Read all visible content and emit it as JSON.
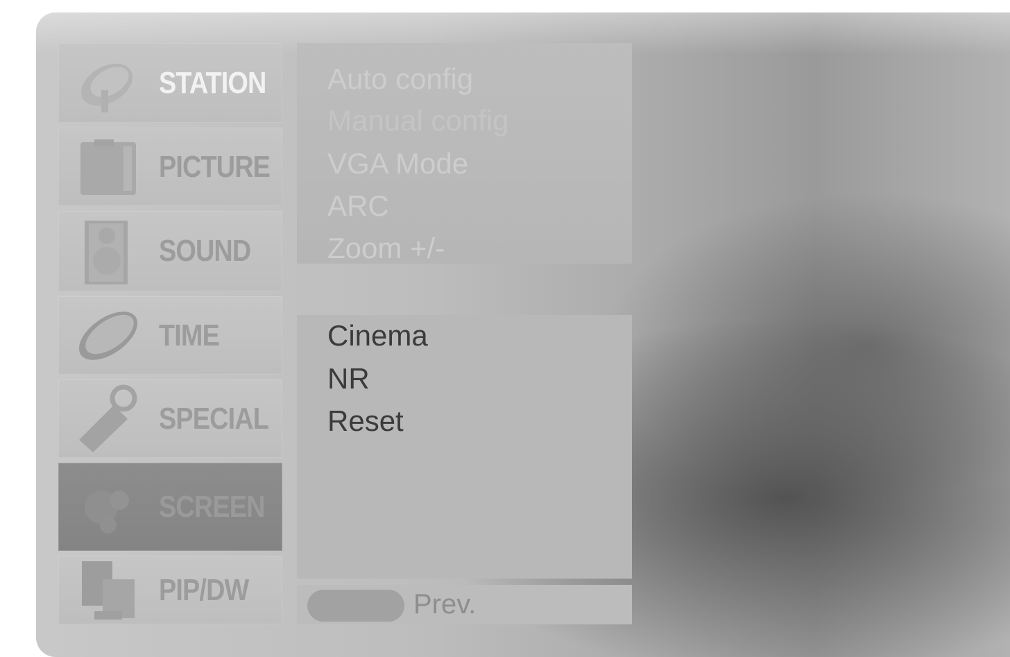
{
  "main_menu": {
    "items": [
      {
        "label": "STATION",
        "icon": "satellite-dish-icon"
      },
      {
        "label": "PICTURE",
        "icon": "picture-frame-icon"
      },
      {
        "label": "SOUND",
        "icon": "speaker-icon"
      },
      {
        "label": "TIME",
        "icon": "clock-icon"
      },
      {
        "label": "SPECIAL",
        "icon": "tag-icon"
      },
      {
        "label": "SCREEN",
        "icon": "screen-icon",
        "selected": true
      },
      {
        "label": "PIP/DW",
        "icon": "pip-windows-icon"
      }
    ]
  },
  "submenu": {
    "items": [
      "Auto config",
      "Manual config",
      "VGA Mode",
      "ARC",
      "Zoom +/-",
      "Cinema",
      "NR",
      "Reset"
    ]
  },
  "footer": {
    "prev_label": "Prev."
  }
}
